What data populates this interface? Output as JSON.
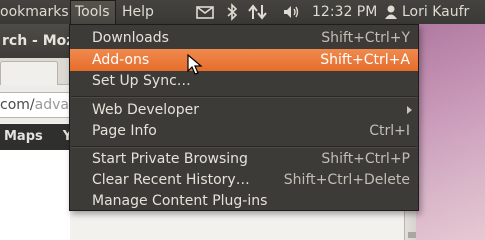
{
  "panel": {
    "menus": [
      "ookmarks",
      "Tools",
      "Help"
    ],
    "clock": "12:32 PM",
    "username": "Lori Kaufr"
  },
  "browser": {
    "title": "rch - Mozi",
    "url_visible": "com/",
    "url_dim": "adva",
    "bookmarks": [
      "Maps",
      "Yo"
    ]
  },
  "menu": {
    "items": [
      {
        "label": "Downloads",
        "accel": "Shift+Ctrl+Y"
      },
      {
        "label": "Add-ons",
        "accel": "Shift+Ctrl+A"
      },
      {
        "label": "Set Up Sync…",
        "accel": ""
      },
      {
        "label": "Web Developer",
        "accel": ""
      },
      {
        "label": "Page Info",
        "accel": "Ctrl+I"
      },
      {
        "label": "Start Private Browsing",
        "accel": "Shift+Ctrl+P"
      },
      {
        "label": "Clear Recent History…",
        "accel": "Shift+Ctrl+Delete"
      },
      {
        "label": "Manage Content Plug-ins",
        "accel": ""
      }
    ]
  },
  "colors": {
    "highlight": "#ec7a3c",
    "panel": "#3c3b37",
    "menu": "#3c3b37"
  },
  "icons": [
    "mail-icon",
    "bluetooth-icon",
    "network-icon",
    "volume-icon",
    "user-icon",
    "mouse-cursor-icon"
  ]
}
